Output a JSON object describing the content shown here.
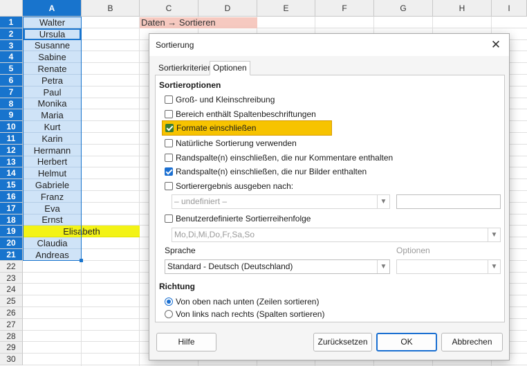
{
  "spreadsheet": {
    "columns": [
      "A",
      "B",
      "C",
      "D",
      "E",
      "F",
      "G",
      "H",
      "I"
    ],
    "rows": [
      "1",
      "2",
      "3",
      "4",
      "5",
      "6",
      "7",
      "8",
      "9",
      "10",
      "11",
      "12",
      "13",
      "14",
      "15",
      "16",
      "17",
      "18",
      "19",
      "20",
      "21",
      "22",
      "23",
      "24",
      "25",
      "26",
      "27",
      "28",
      "29",
      "30"
    ],
    "names": [
      "Walter",
      "Ursula",
      "Susanne",
      "Sabine",
      "Renate",
      "Petra",
      "Paul",
      "Monika",
      "Maria",
      "Kurt",
      "Karin",
      "Hermann",
      "Herbert",
      "Helmut",
      "Gabriele",
      "Franz",
      "Eva",
      "Ernst",
      "Elisabeth",
      "Claudia",
      "Andreas"
    ],
    "note": "Daten → Sortieren",
    "highlight_color": "#f3f316",
    "selection_color": "#cfe3f7"
  },
  "dialog": {
    "title": "Sortierung",
    "tabs": [
      "Sortierkriterien",
      "Optionen"
    ],
    "section_sort_options": "Sortieroptionen",
    "options": [
      {
        "label": "Groß- und Kleinschreibung",
        "checked": false
      },
      {
        "label": "Bereich enthält Spaltenbeschriftungen",
        "checked": false
      },
      {
        "label": "Formate einschließen",
        "checked": true
      },
      {
        "label": "Natürliche Sortierung verwenden",
        "checked": false
      },
      {
        "label": "Randspalte(n) einschließen, die nur Kommentare enthalten",
        "checked": false
      },
      {
        "label": "Randspalte(n) einschließen, die nur Bilder enthalten",
        "checked": true
      },
      {
        "label": "Sortierergebnis ausgeben nach:",
        "checked": false
      }
    ],
    "output_combo": "– undefiniert –",
    "custom_order_label": "Benutzerdefinierte Sortierreihenfolge",
    "custom_order_combo": "Mo,Di,Mi,Do,Fr,Sa,So",
    "language_label": "Sprache",
    "language_value": "Standard - Deutsch (Deutschland)",
    "options_label": "Optionen",
    "direction_label": "Richtung",
    "direction_options": [
      {
        "label": "Von oben nach unten (Zeilen sortieren)",
        "checked": true
      },
      {
        "label": "Von links nach rechts (Spalten sortieren)",
        "checked": false
      }
    ],
    "buttons": {
      "help": "Hilfe",
      "reset": "Zurücksetzen",
      "ok": "OK",
      "cancel": "Abbrechen"
    },
    "highlight_color": "#f7c300"
  }
}
